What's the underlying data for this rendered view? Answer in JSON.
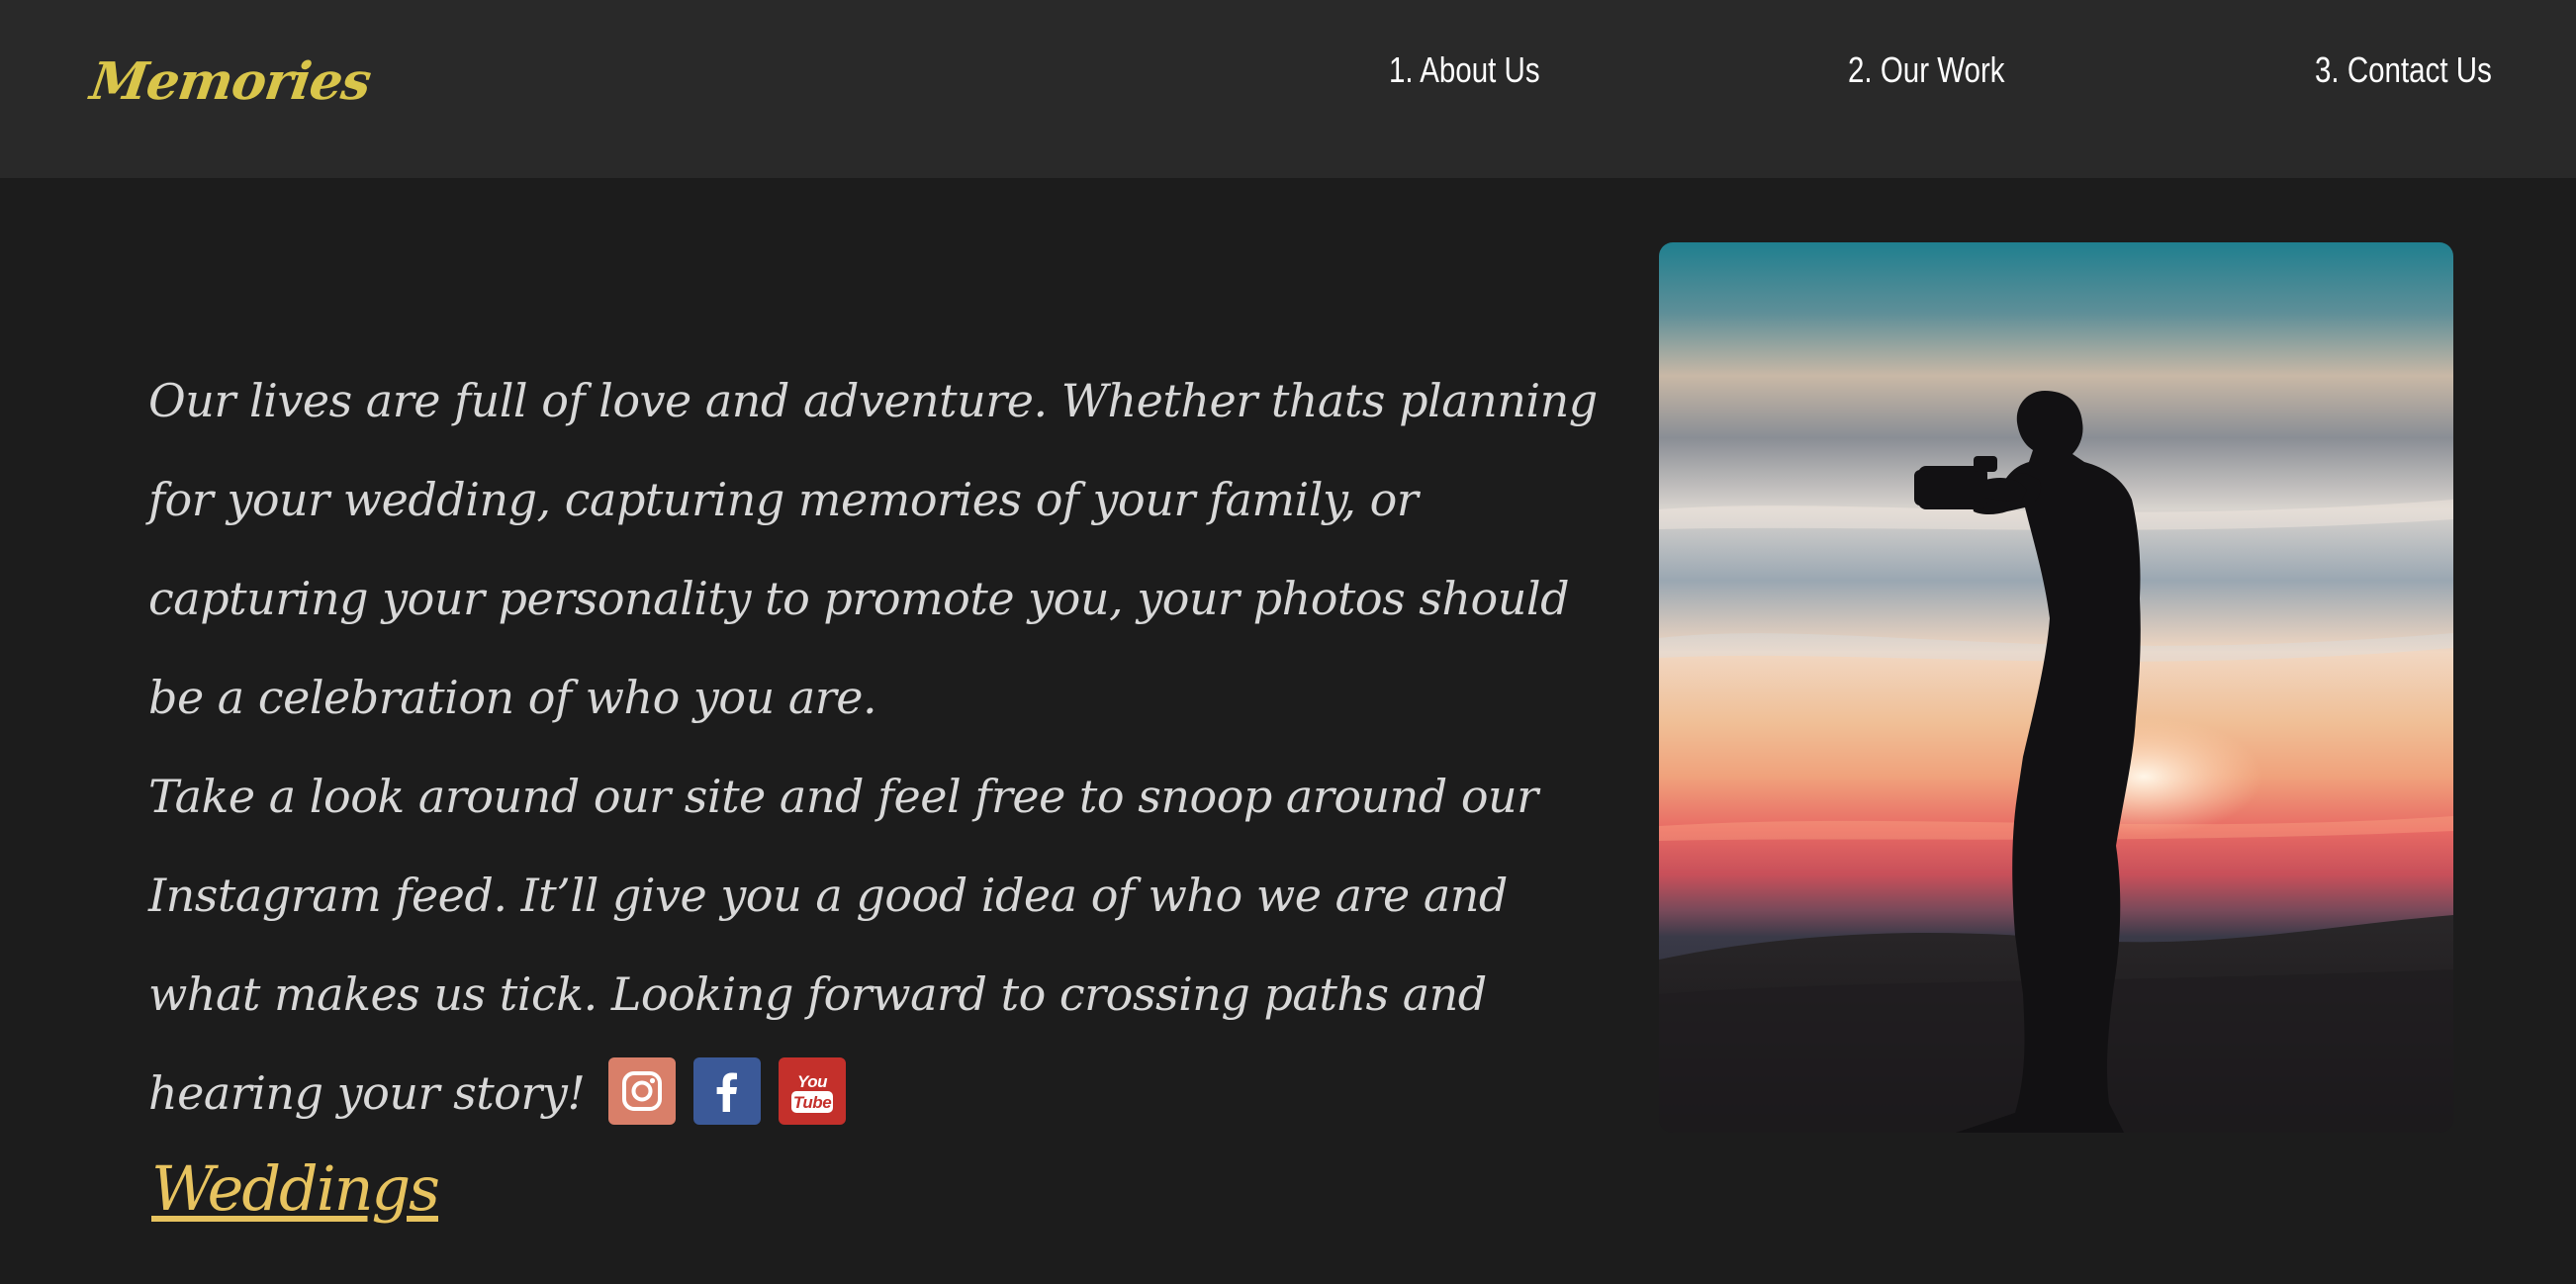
{
  "header": {
    "logo": "Memories",
    "nav": [
      {
        "label": "1. About Us"
      },
      {
        "label": "2. Our Work"
      },
      {
        "label": "3. Contact Us"
      }
    ]
  },
  "intro": {
    "paragraph1": "Our lives are full of love and adventure. Whether thats planning for your wedding, capturing memories of your family, or capturing your personality to promote you, your photos should be a celebration of who you are.",
    "paragraph2": "Take a look around our site and feel free to snoop around our Instagram feed. It’ll give you a good idea of who we are and what makes us tick. Looking forward to crossing paths and hearing your story!"
  },
  "social": [
    {
      "icon": "instagram-icon",
      "color": "#d97f69"
    },
    {
      "icon": "facebook-icon",
      "color": "#3b5998"
    },
    {
      "icon": "youtube-icon",
      "color": "#c4302b",
      "text_top": "You",
      "text_bottom": "Tube"
    }
  ],
  "photo": {
    "subject": "silhouette of photographer with camera at sunset"
  },
  "section": {
    "weddings_title": "Weddings"
  },
  "colors": {
    "header_bg": "#292929",
    "page_bg": "#1c1c1c",
    "logo": "#d9c54a",
    "accent": "#e7c35f",
    "text": "#d8d8d8"
  }
}
